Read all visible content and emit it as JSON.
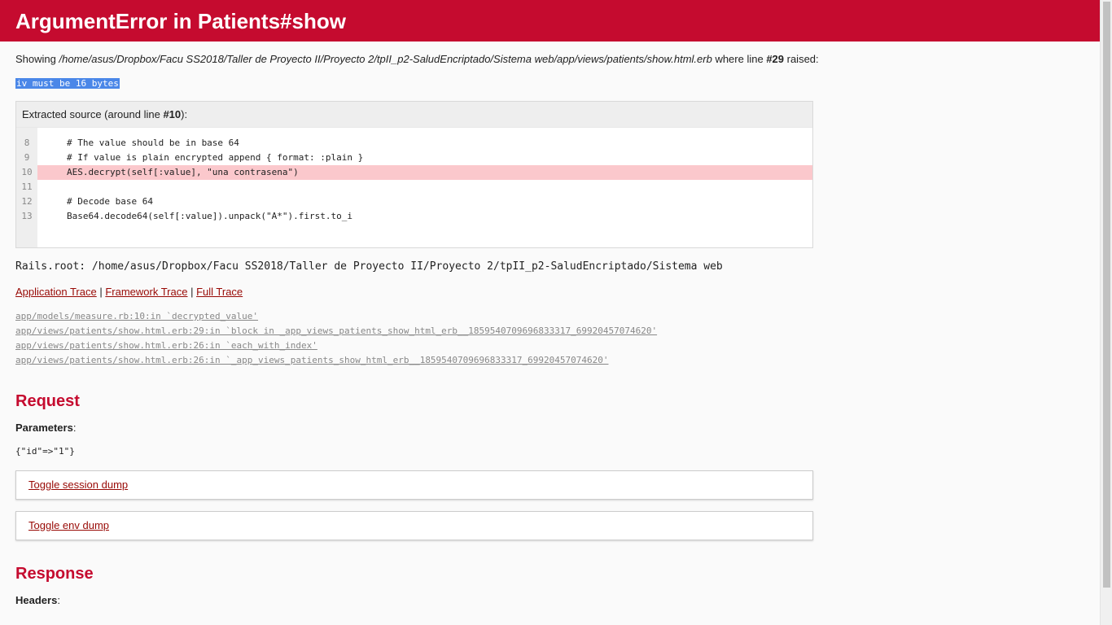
{
  "header": {
    "title": "ArgumentError in Patients#show"
  },
  "showing": {
    "prefix": "Showing ",
    "path": "/home/asus/Dropbox/Facu SS2018/Taller de Proyecto II/Proyecto 2/tpII_p2-SaludEncriptado/Sistema web/app/views/patients/show.html.erb",
    "middle": " where line ",
    "line": "#29",
    "suffix": " raised:"
  },
  "error_message": "iv must be 16 bytes",
  "extracted_source": {
    "header_prefix": "Extracted source (around line ",
    "header_line": "#10",
    "header_suffix": "):",
    "lines": [
      {
        "number": "8",
        "code": "# The value should be in base 64"
      },
      {
        "number": "9",
        "code": "# If value is plain encrypted append { format: :plain }"
      },
      {
        "number": "10",
        "code": "AES.decrypt(self[:value], \"una contrasena\")"
      },
      {
        "number": "11",
        "code": ""
      },
      {
        "number": "12",
        "code": "# Decode base 64"
      },
      {
        "number": "13",
        "code": "Base64.decode64(self[:value]).unpack(\"A*\").first.to_i"
      }
    ]
  },
  "rails_root": "Rails.root: /home/asus/Dropbox/Facu SS2018/Taller de Proyecto II/Proyecto 2/tpII_p2-SaludEncriptado/Sistema web",
  "trace_tabs": {
    "application": "Application Trace",
    "framework": "Framework Trace",
    "full": "Full Trace",
    "separator": " | "
  },
  "trace": [
    "app/models/measure.rb:10:in `decrypted_value'",
    "app/views/patients/show.html.erb:29:in `block in _app_views_patients_show_html_erb__1859540709696833317_69920457074620'",
    "app/views/patients/show.html.erb:26:in `each_with_index'",
    "app/views/patients/show.html.erb:26:in `_app_views_patients_show_html_erb__1859540709696833317_69920457074620'"
  ],
  "request": {
    "title": "Request",
    "parameters_label": "Parameters",
    "parameters_value": "{\"id\"=>\"1\"}",
    "toggle_session": "Toggle session dump",
    "toggle_env": "Toggle env dump"
  },
  "response": {
    "title": "Response",
    "headers_label": "Headers"
  },
  "colors": {
    "header_bg": "#c50b2f",
    "accent": "#c50b2f",
    "link": "#980905",
    "highlight_line": "#fbc8cc",
    "selection": "#4a87e8"
  }
}
